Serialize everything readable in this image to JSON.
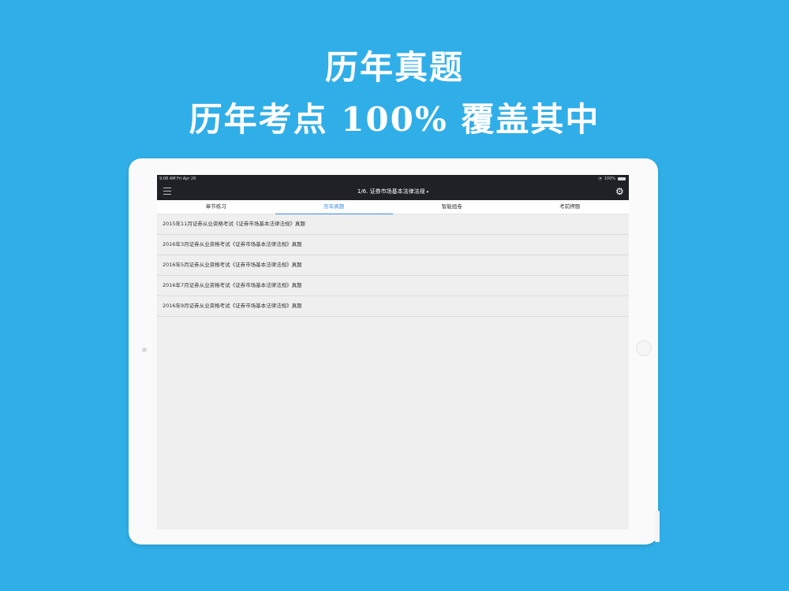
{
  "hero": {
    "line1": "历年真题",
    "line2": "历年考点 100% 覆盖其中"
  },
  "statusbar": {
    "time": "9:08 AM   Fri Apr 26",
    "battery": "100%"
  },
  "navbar": {
    "title": "1/6. 证券市场基本法律法规",
    "caret": "▾"
  },
  "tabs": [
    {
      "label": "章节练习",
      "active": false
    },
    {
      "label": "历年真题",
      "active": true
    },
    {
      "label": "智能组卷",
      "active": false
    },
    {
      "label": "考前押题",
      "active": false
    }
  ],
  "list": [
    {
      "title": "2015年11月证券从业资格考试《证券市场基本法律法规》真题"
    },
    {
      "title": "2016年3月证券从业资格考试《证券市场基本法律法规》真题"
    },
    {
      "title": "2016年5月证券从业资格考试《证券市场基本法律法规》真题"
    },
    {
      "title": "2016年7月证券从业资格考试《证券市场基本法律法规》真题"
    },
    {
      "title": "2016年9月证券从业资格考试《证券市场基本法律法规》真题"
    }
  ],
  "colors": {
    "background": "#30aee8",
    "navbar": "#1f2126",
    "active_tab": "#3a8ee6"
  },
  "icons": {
    "menu": "menu-icon",
    "settings": "gear-icon",
    "wifi": "wifi-icon",
    "battery": "battery-icon",
    "dropdown": "chevron-down-icon"
  }
}
